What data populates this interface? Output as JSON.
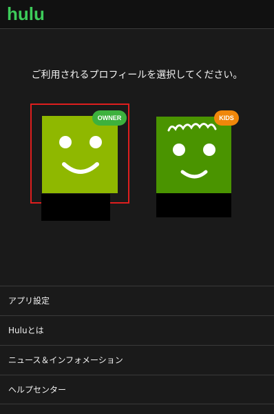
{
  "header": {
    "logo_text": "hulu",
    "brand_color": "#3dcc5a"
  },
  "prompt": "ご利用されるプロフィールを選択してください。",
  "profiles": [
    {
      "badge": "OWNER",
      "avatar_color": "#8fb800",
      "badge_color": "#3db13d",
      "selected": true
    },
    {
      "badge": "KIDS",
      "avatar_color": "#4a9400",
      "badge_color": "#f0870a",
      "selected": false
    }
  ],
  "menu": {
    "items": [
      {
        "label": "アプリ設定"
      },
      {
        "label": "Huluとは"
      },
      {
        "label": "ニュース＆インフォメーション"
      },
      {
        "label": "ヘルプセンター"
      }
    ]
  }
}
